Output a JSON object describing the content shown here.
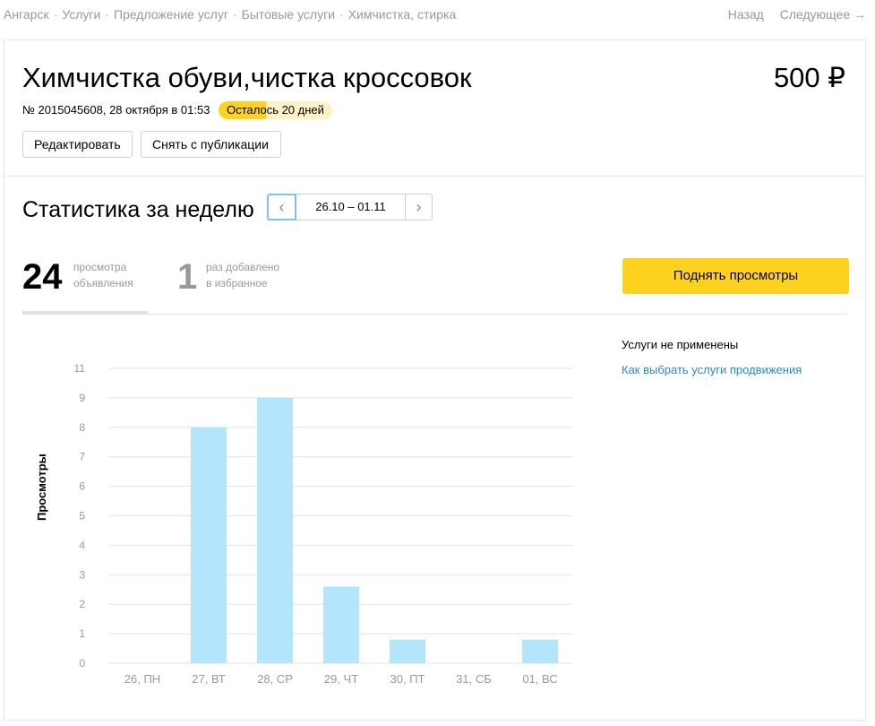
{
  "breadcrumbs": [
    "Ангарск",
    "Услуги",
    "Предложение услуг",
    "Бытовые услуги",
    "Химчистка, стирка"
  ],
  "nav": {
    "back": "Назад",
    "next": "Следующее →"
  },
  "ad": {
    "title": "Химчистка обуви,чистка кроссовок",
    "price": "500 ₽",
    "meta": "№ 2015045608, 28 октября в 01:53",
    "badge": "Осталось 20 дней",
    "badge_progress": 0.42
  },
  "actions": {
    "edit": "Редактировать",
    "unpublish": "Снять с публикации"
  },
  "stats": {
    "title": "Статистика за неделю",
    "range": "26.10 – 01.11",
    "prev_icon": "chevron-left-icon",
    "next_icon": "chevron-right-icon",
    "views": {
      "value": "24",
      "label_line1": "просмотра",
      "label_line2": "объявления"
    },
    "favorites": {
      "value": "1",
      "label_line1": "раз добавлено",
      "label_line2": "в избранное"
    },
    "boost_button": "Поднять просмотры"
  },
  "promo": {
    "note": "Услуги не применены",
    "link": "Как выбрать услуги продвижения"
  },
  "colors": {
    "bar": "#b3e5fc",
    "accent": "#ffd21f",
    "link": "#2a8ac8"
  },
  "chart_data": {
    "type": "bar",
    "categories": [
      "26, ПН",
      "27, ВТ",
      "28, СР",
      "29, ЧТ",
      "30, ПТ",
      "31, СБ",
      "01, ВС"
    ],
    "values": [
      0,
      8,
      9,
      2.6,
      0.8,
      0,
      0.8
    ],
    "ylabel": "Просмотры",
    "yticks": [
      "0",
      "1",
      "2",
      "3",
      "4",
      "5",
      "6",
      "7",
      "8",
      "9",
      "11"
    ],
    "ylim": [
      0,
      10
    ],
    "grid": true
  }
}
